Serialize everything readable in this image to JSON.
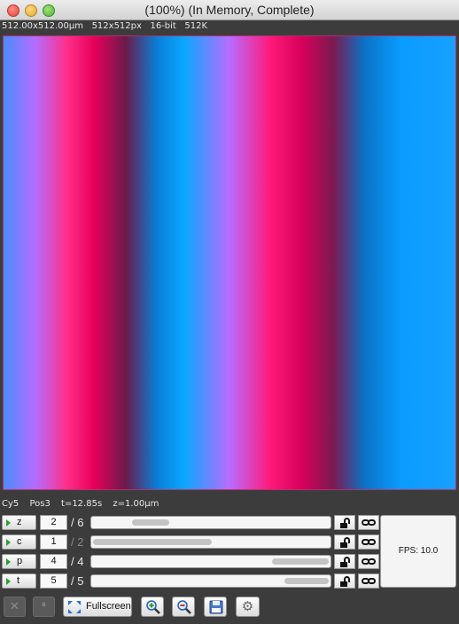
{
  "window": {
    "title": "(100%) (In Memory, Complete)"
  },
  "info_bar": {
    "physical_size": "512.00x512.00µm",
    "pixel_size": "512x512px",
    "bit_depth": "16-bit",
    "memory": "512K"
  },
  "image": {
    "description_colors": [
      "#0aa7ff",
      "#b86cff",
      "#ff1a7a",
      "#7a1a50"
    ],
    "frame_color": "#b0306b"
  },
  "status": {
    "channel": "Cy5",
    "position": "Pos3",
    "time": "t=12.85s",
    "z": "z=1.00µm"
  },
  "dimensions": [
    {
      "label": "z",
      "value": "2",
      "total": "/ 6",
      "enabled": true,
      "position_fraction": 0.2
    },
    {
      "label": "c",
      "value": "1",
      "total": "/ 2",
      "enabled": false,
      "position_fraction": 0.0
    },
    {
      "label": "p",
      "value": "4",
      "total": "/ 4",
      "enabled": true,
      "position_fraction": 1.0
    },
    {
      "label": "t",
      "value": "5",
      "total": "/ 5",
      "enabled": true,
      "position_fraction": 1.0
    }
  ],
  "fps": {
    "label": "FPS: 10.0"
  },
  "toolbar": {
    "fullscreen_label": "Fullscreen",
    "close_icon": "close-icon",
    "pause_icon": "pause-icon",
    "zoom_in_icon": "zoom-in-icon",
    "zoom_out_icon": "zoom-out-icon",
    "save_icon": "save-icon",
    "settings_icon": "gear-icon"
  }
}
